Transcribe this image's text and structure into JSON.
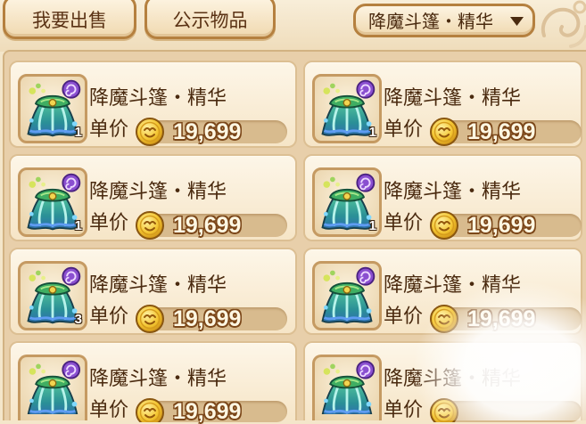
{
  "toolbar": {
    "sell_button": "我要出售",
    "public_items_button": "公示物品",
    "filter_dropdown": {
      "selected": "降魔斗篷・精华"
    }
  },
  "labels": {
    "unit_price": "单价"
  },
  "icons": {
    "item": "cloak-icon",
    "currency": "coin-icon",
    "dropdown": "triangle-down-icon",
    "decoration": "swirl-icon"
  },
  "listings": [
    {
      "name": "降魔斗篷・精华",
      "price": "19,699",
      "quantity": "1"
    },
    {
      "name": "降魔斗篷・精华",
      "price": "19,699",
      "quantity": "1"
    },
    {
      "name": "降魔斗篷・精华",
      "price": "19,699",
      "quantity": "1"
    },
    {
      "name": "降魔斗篷・精华",
      "price": "19,699",
      "quantity": "1"
    },
    {
      "name": "降魔斗篷・精华",
      "price": "19,699",
      "quantity": "3"
    },
    {
      "name": "降魔斗篷・精华",
      "price": "19,699"
    },
    {
      "name": "降魔斗篷・精华",
      "price": "19,699"
    },
    {
      "name": "降魔斗篷・精华"
    }
  ],
  "colors": {
    "background": "#f4e6ca",
    "panel": "#e8cfaa",
    "card": "#fbf1df",
    "text": "#4a2a0f",
    "button_border": "#b5803f",
    "price_bar": "#d8bb8e",
    "price_text": "#fff7e2",
    "coin": "#f3c531",
    "swirl": "#8a4fd0"
  }
}
